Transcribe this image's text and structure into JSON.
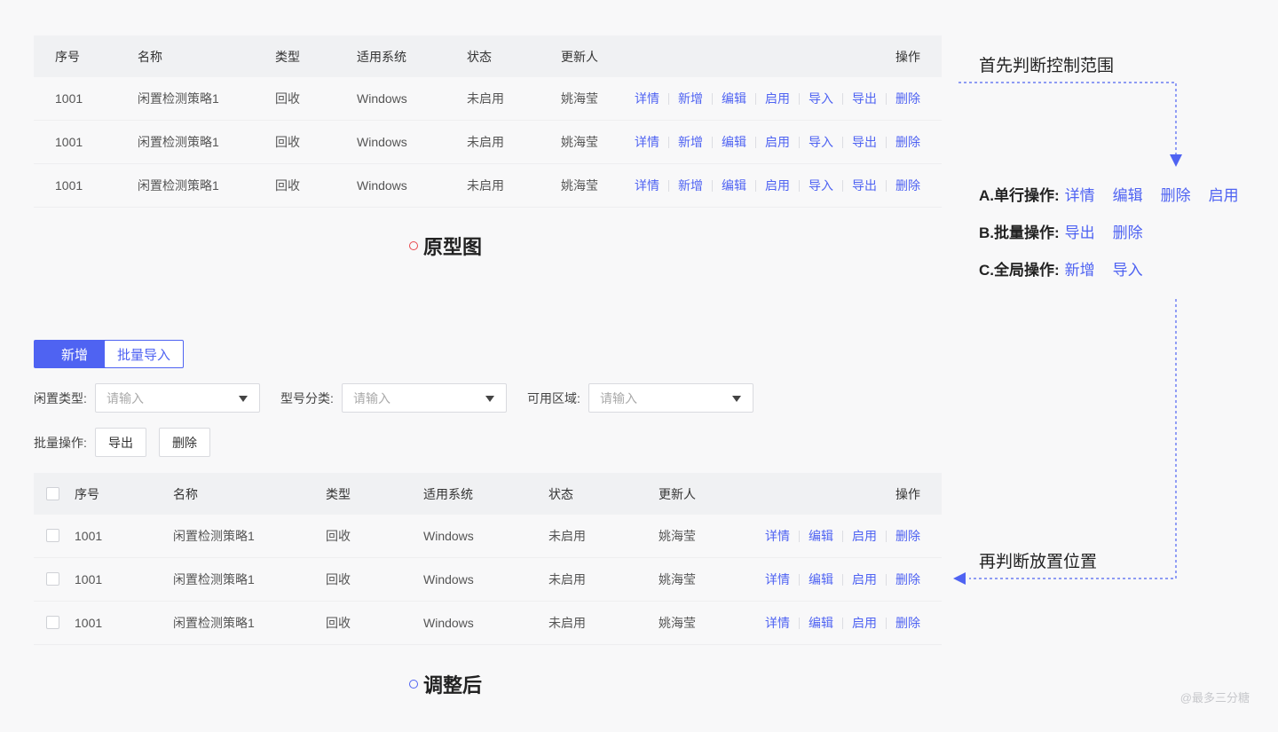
{
  "columns_a": [
    "序号",
    "名称",
    "类型",
    "适用系统",
    "状态",
    "更新人",
    "操作"
  ],
  "rows_a": [
    {
      "id": "1001",
      "name": "闲置检测策略1",
      "type": "回收",
      "system": "Windows",
      "status": "未启用",
      "updater": "姚海莹"
    },
    {
      "id": "1001",
      "name": "闲置检测策略1",
      "type": "回收",
      "system": "Windows",
      "status": "未启用",
      "updater": "姚海莹"
    },
    {
      "id": "1001",
      "name": "闲置检测策略1",
      "type": "回收",
      "system": "Windows",
      "status": "未启用",
      "updater": "姚海莹"
    }
  ],
  "ops_a": [
    "详情",
    "新增",
    "编辑",
    "启用",
    "导入",
    "导出",
    "删除"
  ],
  "caption_a": "原型图",
  "toolbar": {
    "add_label": "新增",
    "batch_import_label": "批量导入"
  },
  "filters": [
    {
      "label": "闲置类型:",
      "placeholder": "请输入"
    },
    {
      "label": "型号分类:",
      "placeholder": "请输入"
    },
    {
      "label": "可用区域:",
      "placeholder": "请输入"
    }
  ],
  "batch": {
    "label": "批量操作:",
    "export_label": "导出",
    "delete_label": "删除"
  },
  "columns_b": [
    "序号",
    "名称",
    "类型",
    "适用系统",
    "状态",
    "更新人",
    "操作"
  ],
  "rows_b": [
    {
      "id": "1001",
      "name": "闲置检测策略1",
      "type": "回收",
      "system": "Windows",
      "status": "未启用",
      "updater": "姚海莹"
    },
    {
      "id": "1001",
      "name": "闲置检测策略1",
      "type": "回收",
      "system": "Windows",
      "status": "未启用",
      "updater": "姚海莹"
    },
    {
      "id": "1001",
      "name": "闲置检测策略1",
      "type": "回收",
      "system": "Windows",
      "status": "未启用",
      "updater": "姚海莹"
    }
  ],
  "ops_b": [
    "详情",
    "编辑",
    "启用",
    "删除"
  ],
  "caption_b": "调整后",
  "annotations": {
    "step1": "首先判断控制范围",
    "step2": "再判断放置位置",
    "rules": [
      {
        "label": "A.单行操作:",
        "items": [
          "详情",
          "编辑",
          "删除",
          "启用"
        ]
      },
      {
        "label": "B.批量操作:",
        "items": [
          "导出",
          "删除"
        ]
      },
      {
        "label": "C.全局操作:",
        "items": [
          "新增",
          "导入"
        ]
      }
    ]
  },
  "watermark": "@最多三分糖",
  "colors": {
    "accent": "#4f63f2",
    "caption_a_dot": "#e8474c",
    "caption_b_dot": "#4f63f2"
  }
}
